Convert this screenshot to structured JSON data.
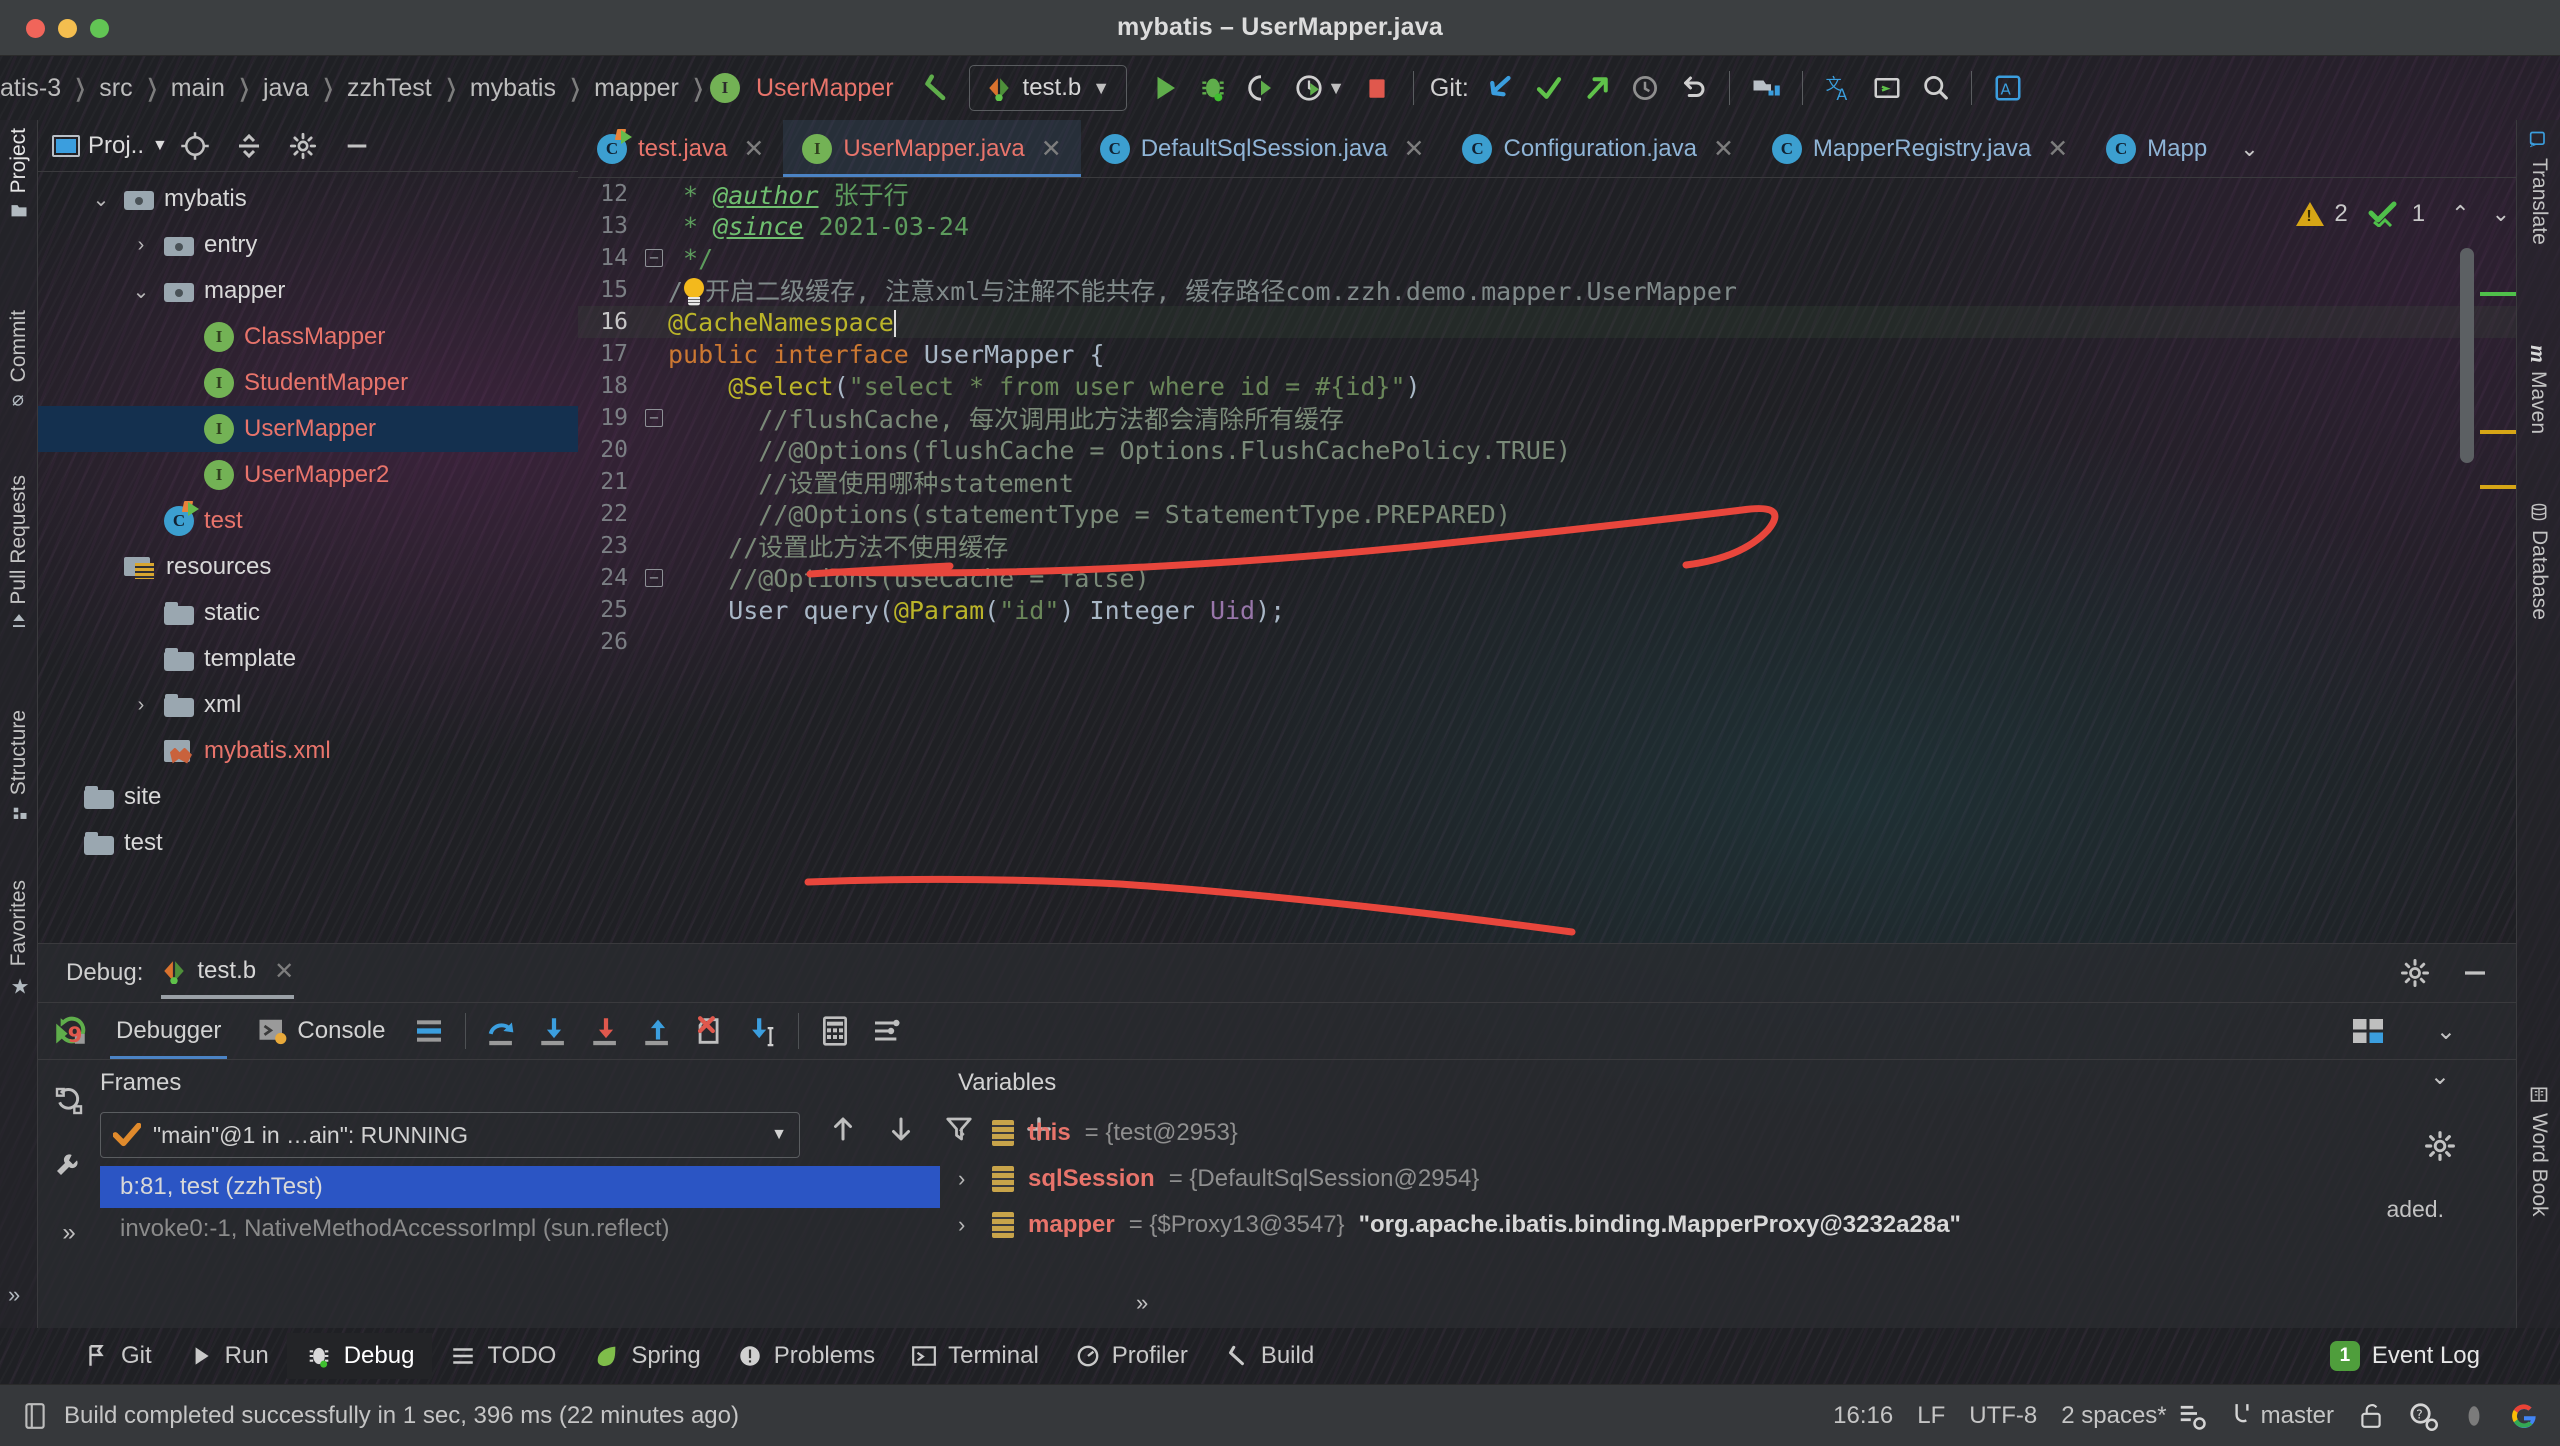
{
  "window": {
    "title": "mybatis – UserMapper.java"
  },
  "breadcrumb": {
    "items": [
      "atis-3",
      "src",
      "main",
      "java",
      "zzhTest",
      "mybatis",
      "mapper"
    ],
    "active": "UserMapper"
  },
  "toolbar": {
    "run_config": "test.b",
    "git_label": "Git:",
    "icons": [
      "build-arrow-icon",
      "run-icon",
      "debug-icon",
      "run-with-coverage-icon",
      "profile-icon",
      "stop-icon",
      "git-update-icon",
      "git-commit-icon",
      "git-push-icon",
      "git-history-icon",
      "git-rollback-icon",
      "project-structure-icon",
      "translate-icon",
      "terminal-icon",
      "search-icon",
      "ai-assistant-icon"
    ]
  },
  "left_rail": {
    "items": [
      "Project",
      "Commit",
      "Pull Requests",
      "Structure",
      "Favorites"
    ],
    "selected": "Project"
  },
  "right_rail": {
    "items": [
      "Translate",
      "Maven",
      "Database",
      "Word Book"
    ]
  },
  "project": {
    "title": "Proj..",
    "tree": [
      {
        "label": "mybatis",
        "indent": 1,
        "arrow": "down",
        "icon": "package-icon",
        "color": "white"
      },
      {
        "label": "entry",
        "indent": 2,
        "arrow": "right",
        "icon": "package-icon",
        "color": "white"
      },
      {
        "label": "mapper",
        "indent": 2,
        "arrow": "down",
        "icon": "package-icon",
        "color": "white"
      },
      {
        "label": "ClassMapper",
        "indent": 3,
        "arrow": "",
        "icon": "interface-icon",
        "color": "red"
      },
      {
        "label": "StudentMapper",
        "indent": 3,
        "arrow": "",
        "icon": "interface-icon",
        "color": "red"
      },
      {
        "label": "UserMapper",
        "indent": 3,
        "arrow": "",
        "icon": "interface-icon",
        "color": "red",
        "selected": true
      },
      {
        "label": "UserMapper2",
        "indent": 3,
        "arrow": "",
        "icon": "interface-icon",
        "color": "red"
      },
      {
        "label": "test",
        "indent": 2,
        "arrow": "",
        "icon": "runnable-class-icon",
        "color": "red"
      },
      {
        "label": "resources",
        "indent": 1,
        "arrow": "",
        "icon": "resources-folder-icon",
        "color": "white"
      },
      {
        "label": "static",
        "indent": 2,
        "arrow": "",
        "icon": "folder-icon",
        "color": "white"
      },
      {
        "label": "template",
        "indent": 2,
        "arrow": "",
        "icon": "folder-icon",
        "color": "white"
      },
      {
        "label": "xml",
        "indent": 2,
        "arrow": "right",
        "icon": "folder-icon",
        "color": "white"
      },
      {
        "label": "mybatis.xml",
        "indent": 2,
        "arrow": "",
        "icon": "xml-file-icon",
        "color": "red"
      },
      {
        "label": "site",
        "indent": 0,
        "arrow": "",
        "icon": "folder-icon",
        "color": "white"
      },
      {
        "label": "test",
        "indent": 0,
        "arrow": "",
        "icon": "folder-icon",
        "color": "white"
      }
    ]
  },
  "editor_tabs": [
    {
      "label": "test.java",
      "icon": "class-icon",
      "selected": false,
      "color": "red"
    },
    {
      "label": "UserMapper.java",
      "icon": "interface-icon",
      "selected": true,
      "color": "red"
    },
    {
      "label": "DefaultSqlSession.java",
      "icon": "class-icon",
      "selected": false,
      "color": "blue"
    },
    {
      "label": "Configuration.java",
      "icon": "class-icon",
      "selected": false,
      "color": "blue"
    },
    {
      "label": "MapperRegistry.java",
      "icon": "class-icon",
      "selected": false,
      "color": "blue"
    },
    {
      "label": "Mapp",
      "icon": "class-icon",
      "selected": false,
      "color": "blue"
    }
  ],
  "inspection": {
    "warnings": "2",
    "oks": "1"
  },
  "code": {
    "lines": [
      {
        "n": "12",
        "segments": [
          {
            "t": " * ",
            "c": "c-doc"
          },
          {
            "t": "@author",
            "c": "c-docTag"
          },
          {
            "t": " 张于行",
            "c": "c-doc"
          }
        ]
      },
      {
        "n": "13",
        "segments": [
          {
            "t": " * ",
            "c": "c-doc"
          },
          {
            "t": "@since",
            "c": "c-docTag"
          },
          {
            "t": " 2021-03-24",
            "c": "c-doc"
          }
        ]
      },
      {
        "n": "14",
        "fold": true,
        "segments": [
          {
            "t": " */",
            "c": "c-doc"
          }
        ]
      },
      {
        "n": "15",
        "bulb": true,
        "segments": [
          {
            "t": "/",
            "c": "c-cmtcn"
          },
          {
            "t": "开启二级缓存, 注意xml与注解不能共存, 缓存路径com.zzh.demo.mapper.UserMapper",
            "c": "c-cmtcn"
          }
        ]
      },
      {
        "n": "16",
        "current": true,
        "highlight": true,
        "caret": true,
        "segments": [
          {
            "t": "@CacheNamespace",
            "c": "c-ann"
          }
        ]
      },
      {
        "n": "17",
        "segments": [
          {
            "t": "public interface ",
            "c": "c-kw"
          },
          {
            "t": "UserMapper ",
            "c": "c-txt"
          },
          {
            "t": "{",
            "c": "c-txt"
          }
        ]
      },
      {
        "n": "18",
        "segments": [
          {
            "t": "    ",
            "c": "c-txt"
          },
          {
            "t": "@Select",
            "c": "c-ann"
          },
          {
            "t": "(",
            "c": "c-txt"
          },
          {
            "t": "\"select * from user where id = #{id}\"",
            "c": "c-str"
          },
          {
            "t": ")",
            "c": "c-txt"
          }
        ]
      },
      {
        "n": "19",
        "fold": true,
        "segments": [
          {
            "t": "      //flushCache, 每次调用此方法都会清除所有缓存",
            "c": "c-cmt"
          }
        ]
      },
      {
        "n": "20",
        "segments": [
          {
            "t": "      //@Options(flushCache = Options.FlushCachePolicy.TRUE)",
            "c": "c-cmt"
          }
        ]
      },
      {
        "n": "21",
        "segments": [
          {
            "t": "      //设置使用哪种statement",
            "c": "c-cmt"
          }
        ]
      },
      {
        "n": "22",
        "segments": [
          {
            "t": "      //@Options(statementType = StatementType.PREPARED)",
            "c": "c-cmt"
          }
        ]
      },
      {
        "n": "23",
        "segments": [
          {
            "t": "    //设置此方法不使用缓存",
            "c": "c-cmt"
          }
        ]
      },
      {
        "n": "24",
        "fold": true,
        "segments": [
          {
            "t": "    //@Options(useCache = false)",
            "c": "c-cmt"
          }
        ]
      },
      {
        "n": "25",
        "segments": [
          {
            "t": "    ",
            "c": "c-txt"
          },
          {
            "t": "User ",
            "c": "c-txt"
          },
          {
            "t": "query",
            "c": "c-txt"
          },
          {
            "t": "(",
            "c": "c-txt"
          },
          {
            "t": "@Param",
            "c": "c-ann"
          },
          {
            "t": "(",
            "c": "c-txt"
          },
          {
            "t": "\"id\"",
            "c": "c-str"
          },
          {
            "t": ") ",
            "c": "c-txt"
          },
          {
            "t": "Integer ",
            "c": "c-txt"
          },
          {
            "t": "Uid",
            "c": "c-parm"
          },
          {
            "t": ");",
            "c": "c-txt"
          }
        ]
      },
      {
        "n": "26",
        "segments": [
          {
            "t": "",
            "c": "c-txt"
          }
        ]
      }
    ]
  },
  "debug": {
    "label": "Debug:",
    "session_tab": "test.b",
    "tabs": [
      {
        "label": "Debugger",
        "icon": "debugger-icon",
        "selected": true
      },
      {
        "label": "Console",
        "icon": "console-icon",
        "selected": false
      }
    ],
    "step_icons": [
      "layout-icon",
      "step-over-icon",
      "step-into-icon",
      "force-step-into-icon",
      "step-out-icon",
      "drop-frame-icon",
      "run-to-cursor-icon",
      "evaluate-icon",
      "settings-list-icon"
    ],
    "frames_title": "Frames",
    "thread": "\"main\"@1 in …ain\": RUNNING",
    "frames": [
      {
        "label": "b:81, test (zzhTest)",
        "selected": true
      },
      {
        "label": "invoke0:-1, NativeMethodAccessorImpl (sun.reflect)",
        "selected": false
      }
    ],
    "variables_title": "Variables",
    "variables": [
      {
        "name": "this",
        "value": "= {test@2953}",
        "str": ""
      },
      {
        "name": "sqlSession",
        "value": "= {DefaultSqlSession@2954}",
        "str": ""
      },
      {
        "name": "mapper",
        "value": "= {$Proxy13@3547}",
        "str": "\"org.apache.ibatis.binding.MapperProxy@3232a28a\""
      }
    ],
    "console_tail": "aded."
  },
  "bottom_bar": {
    "items": [
      {
        "label": "Git",
        "icon": "git-icon",
        "selected": false
      },
      {
        "label": "Run",
        "icon": "run-icon",
        "selected": false
      },
      {
        "label": "Debug",
        "icon": "debug-icon",
        "selected": true
      },
      {
        "label": "TODO",
        "icon": "todo-icon",
        "selected": false
      },
      {
        "label": "Spring",
        "icon": "spring-icon",
        "selected": false
      },
      {
        "label": "Problems",
        "icon": "problems-icon",
        "selected": false
      },
      {
        "label": "Terminal",
        "icon": "terminal-icon",
        "selected": false
      },
      {
        "label": "Profiler",
        "icon": "profiler-icon",
        "selected": false
      },
      {
        "label": "Build",
        "icon": "build-icon",
        "selected": false
      }
    ],
    "event_log": "Event Log",
    "event_count": "1"
  },
  "status_bar": {
    "message": "Build completed successfully in 1 sec, 396 ms (22 minutes ago)",
    "time": "16:16",
    "line_sep": "LF",
    "encoding": "UTF-8",
    "indent": "2 spaces*",
    "branch": "master"
  },
  "colors": {
    "accent_blue": "#4b83c4",
    "selection_blue": "#2b55c4",
    "annotation_red": "#e8463c",
    "warning_yellow": "#d6a516",
    "ok_green": "#4f9e3c",
    "string_green": "#6a8759",
    "keyword_orange": "#cc7832",
    "annotation_yellow": "#bbb529"
  }
}
